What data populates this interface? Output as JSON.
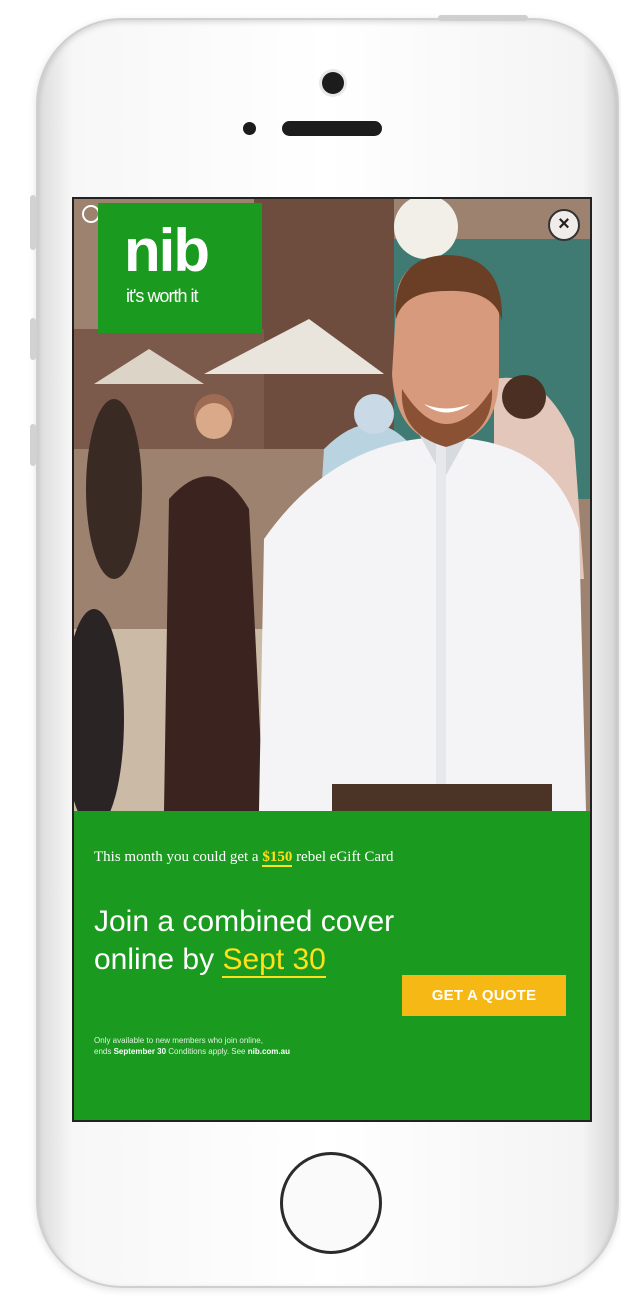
{
  "logo": {
    "word": "nib",
    "tagline": "it's worth it"
  },
  "close": {
    "symbol": "×"
  },
  "promo": {
    "line_before": "This month you could get a ",
    "amount": "$150",
    "line_after": " rebel eGift Card",
    "headline_line1": "Join a combined cover",
    "headline_line2_before": "online by ",
    "headline_date": "Sept 30",
    "cta_label": "GET A QUOTE",
    "terms_part1": "Only available to new members who join online,",
    "terms_part2": "ends ",
    "terms_date": "September 30",
    "terms_part3": " Conditions apply. See ",
    "terms_site": "nib.com.au"
  },
  "colors": {
    "brand_green": "#1a9a1f",
    "cta_yellow": "#f6b814",
    "highlight_yellow": "#ffe01b"
  }
}
